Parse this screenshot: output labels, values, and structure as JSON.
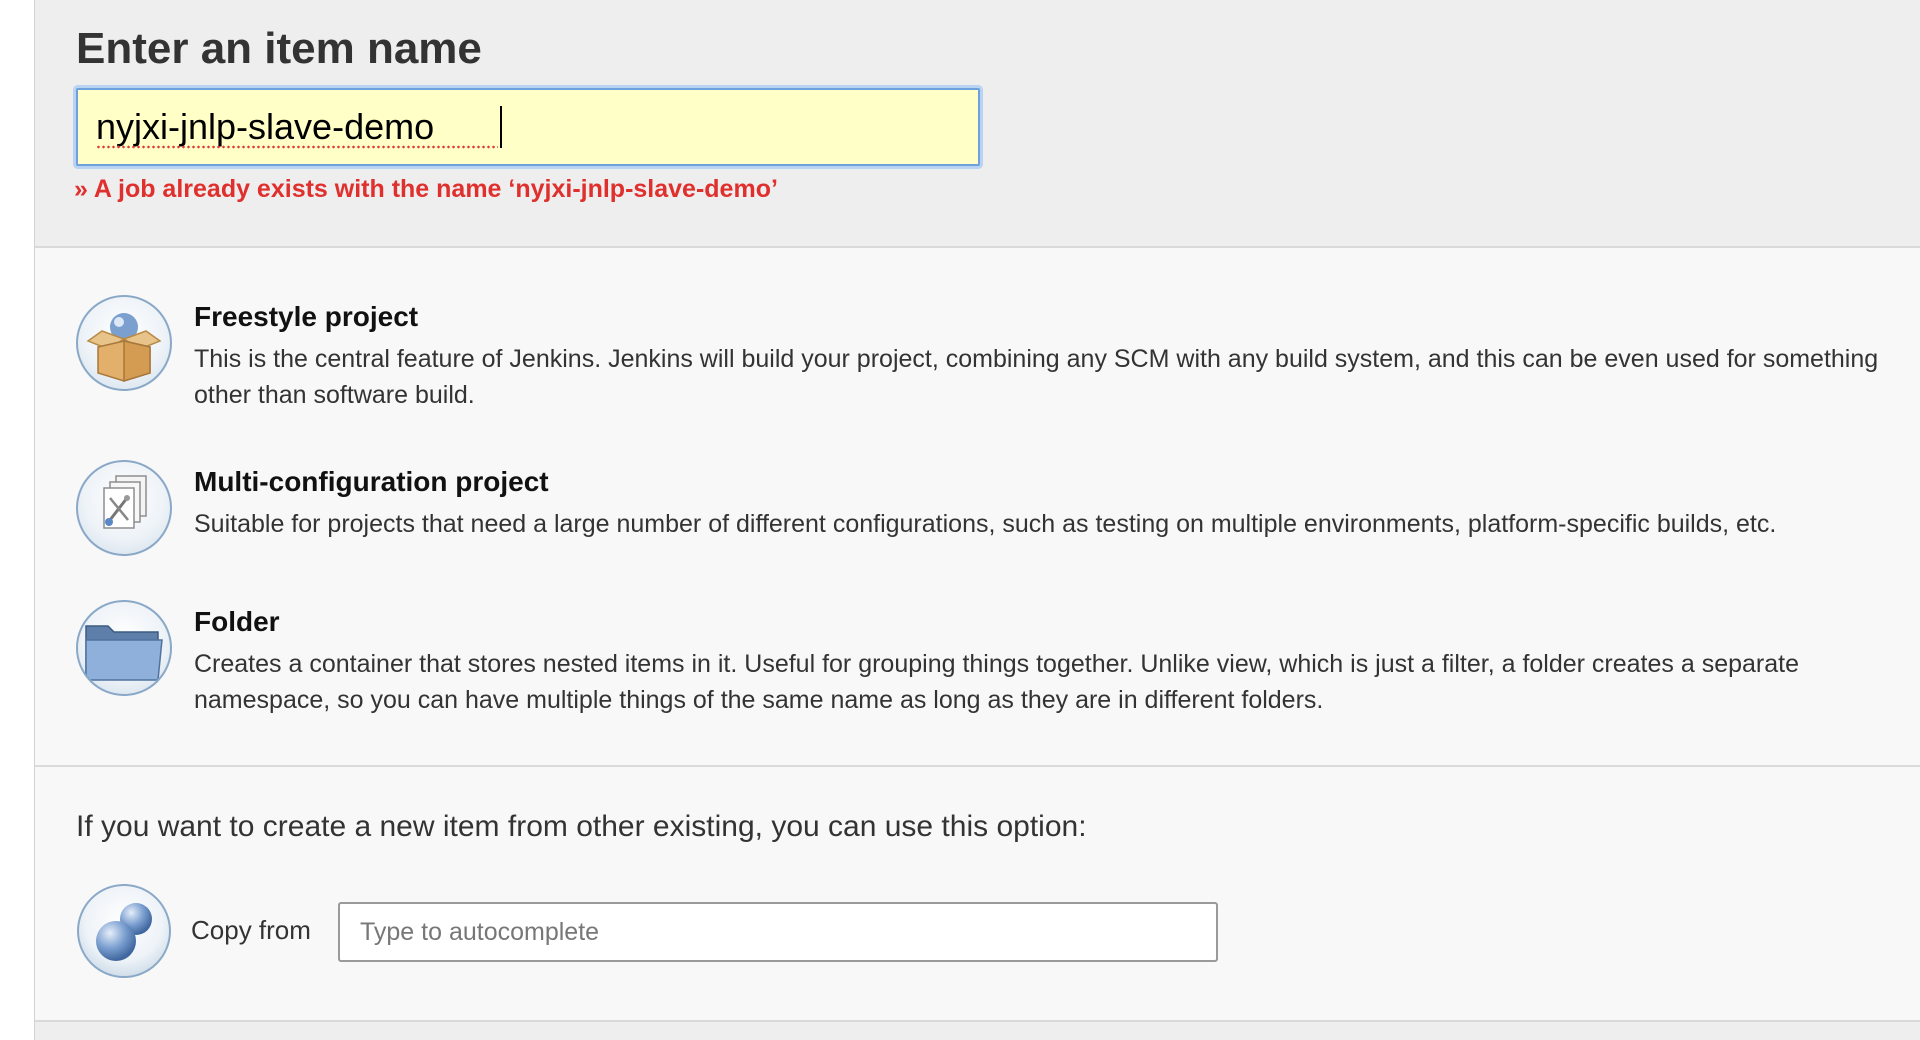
{
  "header": {
    "title": "Enter an item name",
    "item_name_value": "nyjxi-jnlp-slave-demo",
    "error_message": "» A job already exists with the name ‘nyjxi-jnlp-slave-demo’"
  },
  "items": [
    {
      "title": "Freestyle project",
      "description": "This is the central feature of Jenkins. Jenkins will build your project, combining any SCM with any build system, and this can be even used for something other than software build.",
      "icon": "package-box-icon"
    },
    {
      "title": "Multi-configuration project",
      "description": "Suitable for projects that need a large number of different configurations, such as testing on multiple environments, platform-specific builds, etc.",
      "icon": "multi-config-icon"
    },
    {
      "title": "Folder",
      "description": "Creates a container that stores nested items in it. Useful for grouping things together. Unlike view, which is just a filter, a folder creates a separate namespace, so you can have multiple things of the same name as long as they are in different folders.",
      "icon": "folder-icon"
    }
  ],
  "copy": {
    "intro": "If you want to create a new item from other existing, you can use this option:",
    "label": "Copy from",
    "placeholder": "Type to autocomplete",
    "icon": "copy-spheres-icon"
  },
  "colors": {
    "error": "#e0302e",
    "input_bg": "#ffffc7",
    "input_focus": "#6ea0dd"
  }
}
